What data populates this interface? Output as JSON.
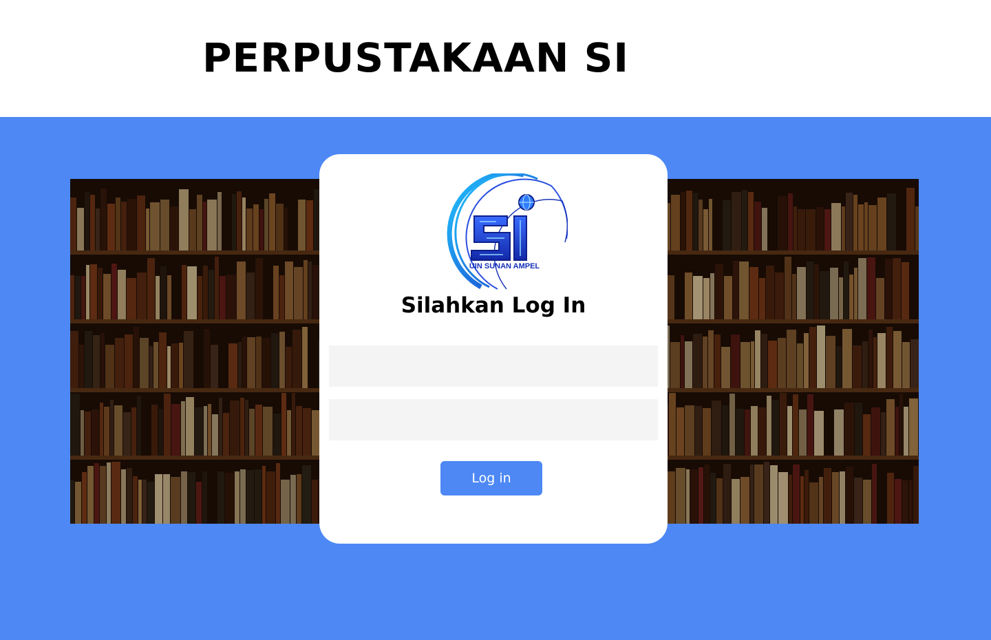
{
  "header": {
    "title": "PERPUSTAKAAN SI"
  },
  "login": {
    "logo_icon": "si-uin-sunan-ampel-logo",
    "logo_text": "UIN SUNAN AMPEL",
    "heading": "Silahkan Log In",
    "username_placeholder": "",
    "password_placeholder": "",
    "button_label": "Log in"
  },
  "colors": {
    "accent": "#4d88f4",
    "card": "#ffffff",
    "field": "#f4f4f4"
  }
}
